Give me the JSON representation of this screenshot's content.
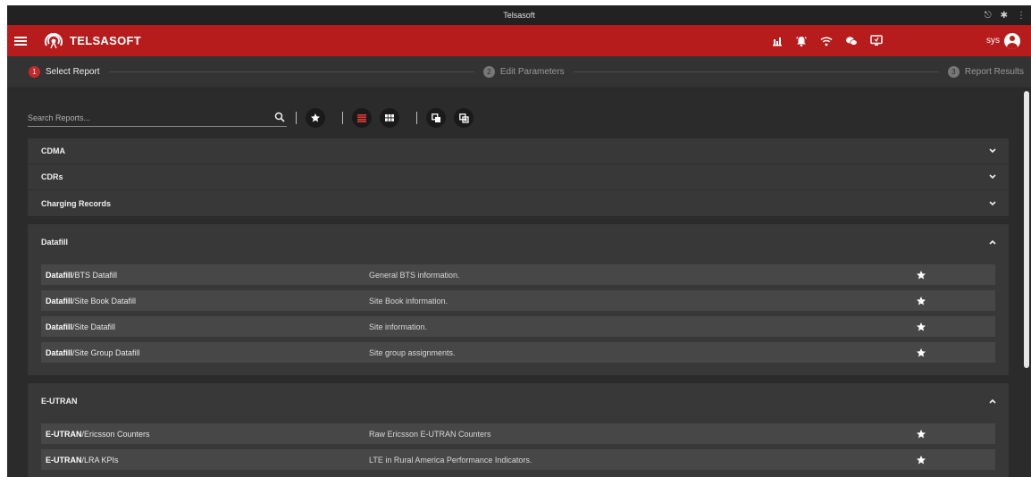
{
  "window": {
    "title": "Telsasoft"
  },
  "appbar": {
    "brand": "TELSASOFT",
    "user": "sys"
  },
  "stepper": {
    "steps": [
      {
        "num": "1",
        "label": "Select Report"
      },
      {
        "num": "2",
        "label": "Edit Parameters"
      },
      {
        "num": "3",
        "label": "Report Results"
      }
    ]
  },
  "search": {
    "placeholder": "Search Reports...",
    "value": ""
  },
  "groups": {
    "collapsed": [
      {
        "label": "CDMA"
      },
      {
        "label": "CDRs"
      },
      {
        "label": "Charging Records"
      }
    ],
    "datafill": {
      "label": "Datafill",
      "reports": [
        {
          "prefix": "Datafill",
          "name": "/BTS Datafill",
          "description": "General BTS information."
        },
        {
          "prefix": "Datafill",
          "name": "/Site Book Datafill",
          "description": "Site Book information."
        },
        {
          "prefix": "Datafill",
          "name": "/Site Datafill",
          "description": "Site information."
        },
        {
          "prefix": "Datafill",
          "name": "/Site Group Datafill",
          "description": "Site group assignments."
        }
      ]
    },
    "eutran": {
      "label": "E-UTRAN",
      "reports": [
        {
          "prefix": "E-UTRAN",
          "name": "/Ericsson Counters",
          "description": "Raw Ericsson E-UTRAN Counters"
        },
        {
          "prefix": "E-UTRAN",
          "name": "/LRA KPIs",
          "description": "LTE in Rural America Performance Indicators."
        }
      ]
    }
  },
  "colors": {
    "appbar": "#b71c1c",
    "active_step": "#c62828",
    "background": "#2b2b2b",
    "panel": "#383838",
    "row": "#474747"
  },
  "icons": [
    "menu-icon",
    "telsasoft-logo-icon",
    "bar-chart-icon",
    "alarm-icon",
    "wifi-icon",
    "chat-icon",
    "monitor-icon",
    "account-icon",
    "search-icon",
    "star-icon",
    "list-view-icon",
    "grid-view-icon",
    "copy-icon",
    "paste-icon",
    "chevron-down-icon",
    "chevron-up-icon",
    "key-icon",
    "extension-icon",
    "kebab-icon"
  ]
}
